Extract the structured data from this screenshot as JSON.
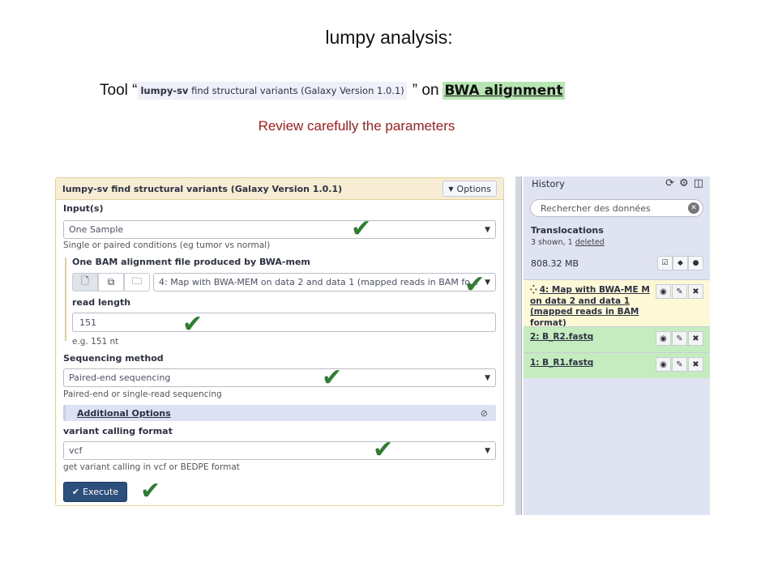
{
  "slide": {
    "title": "lumpy analysis:",
    "intro_prefix": "Tool “",
    "tool_name_bold": "lumpy-sv",
    "tool_name_rest": " find structural variants (Galaxy Version 1.0.1)",
    "intro_suffix": "” on",
    "dataset_link": "BWA alignment",
    "review_note": "Review carefully the parameters"
  },
  "tool": {
    "title": "lumpy-sv find structural variants (Galaxy Version 1.0.1)",
    "options_label": "Options",
    "input_label": "Input(s)",
    "input_value": "One Sample",
    "input_help": "Single or paired conditions (eg tumor vs normal)",
    "bam_label": "One BAM alignment file produced by BWA-mem",
    "bam_value": "4: Map with BWA-MEM on data 2 and data 1 (mapped reads in BAM fo...",
    "read_length_label": "read length",
    "read_length_value": "151",
    "read_length_help": "e.g. 151 nt",
    "seq_method_label": "Sequencing method",
    "seq_method_value": "Paired-end sequencing",
    "seq_method_help": "Paired-end or single-read sequencing",
    "additional_label": "Additional Options",
    "format_label": "variant calling format",
    "format_value": "vcf",
    "format_help": "get variant calling in vcf or BEDPE format",
    "execute_label": "Execute"
  },
  "history": {
    "header": "History",
    "search_placeholder": "Rechercher des données",
    "name": "Translocations",
    "shown_text": "3 shown, 1 ",
    "deleted_text": "deleted",
    "size": "808.32 MB",
    "datasets": [
      {
        "title": "4: Map with BWA-ME M on data 2 and data 1 (mapped reads in BAM format)",
        "state": "queued"
      },
      {
        "title": "2: B_R2.fastq",
        "state": "ok"
      },
      {
        "title": "1: B_R1.fastq",
        "state": "ok"
      }
    ]
  },
  "colors": {
    "accent_green": "#2e7d32",
    "review_red": "#a61c1c",
    "execute_blue": "#2c4f7c",
    "history_bg": "#dfe3f2",
    "dataset_ok": "#c4ecbf",
    "dataset_queued": "#fdf8d6"
  },
  "icons": [
    "check-icon",
    "caret-down-icon",
    "refresh-icon",
    "gear-icon",
    "columns-icon",
    "clear-icon",
    "eye-icon",
    "pencil-icon",
    "delete-icon",
    "spinner-icon",
    "eye-slash-icon",
    "file-icon",
    "copy-icon",
    "folder-icon",
    "tags-icon",
    "comment-icon",
    "select-icon"
  ]
}
